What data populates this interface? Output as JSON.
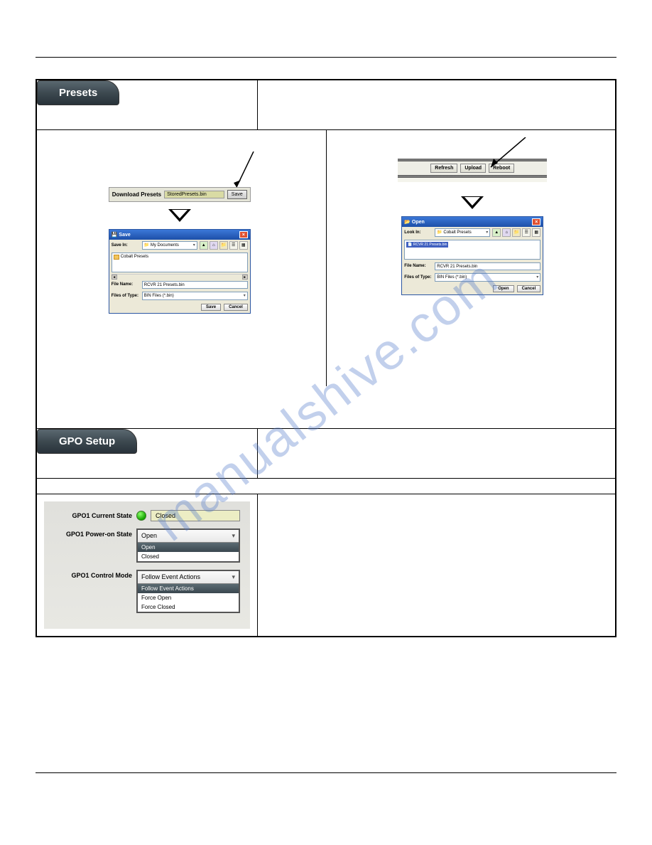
{
  "watermark": "manualshive.com",
  "presets": {
    "tab_label": "Presets",
    "download_label": "Download Presets",
    "download_filename": "StoredPresets.bin",
    "save_btn": "Save",
    "toolbar": {
      "refresh": "Refresh",
      "upload": "Upload",
      "reboot": "Reboot"
    },
    "save_dialog": {
      "title": "Save",
      "save_in_label": "Save In:",
      "save_in_value": "My Documents",
      "folder_item": "Cobalt Presets",
      "filename_label": "File Name:",
      "filename_value": "RCVR 21 Presets.bin",
      "filetype_label": "Files of Type:",
      "filetype_value": "BIN Files (*.bin)",
      "save_btn": "Save",
      "cancel_btn": "Cancel"
    },
    "open_dialog": {
      "title": "Open",
      "look_in_label": "Look In:",
      "look_in_value": "Cobalt Presets",
      "file_item": "RCVR 21 Presets.bin",
      "filename_label": "File Name:",
      "filename_value": "RCVR 21 Presets.bin",
      "filetype_label": "Files of Type:",
      "filetype_value": "BIN Files (*.bin)",
      "open_btn": "Open",
      "cancel_btn": "Cancel"
    }
  },
  "gpo": {
    "tab_label": "GPO Setup",
    "current_state_label": "GPO1 Current State",
    "current_state_value": "Closed",
    "poweron_label": "GPO1 Power-on State",
    "poweron_value": "Open",
    "poweron_opts": {
      "o1": "Open",
      "o2": "Closed"
    },
    "control_label": "GPO1 Control Mode",
    "control_value": "Follow Event Actions",
    "control_opts": {
      "o1": "Follow Event Actions",
      "o2": "Force Open",
      "o3": "Force Closed"
    }
  }
}
